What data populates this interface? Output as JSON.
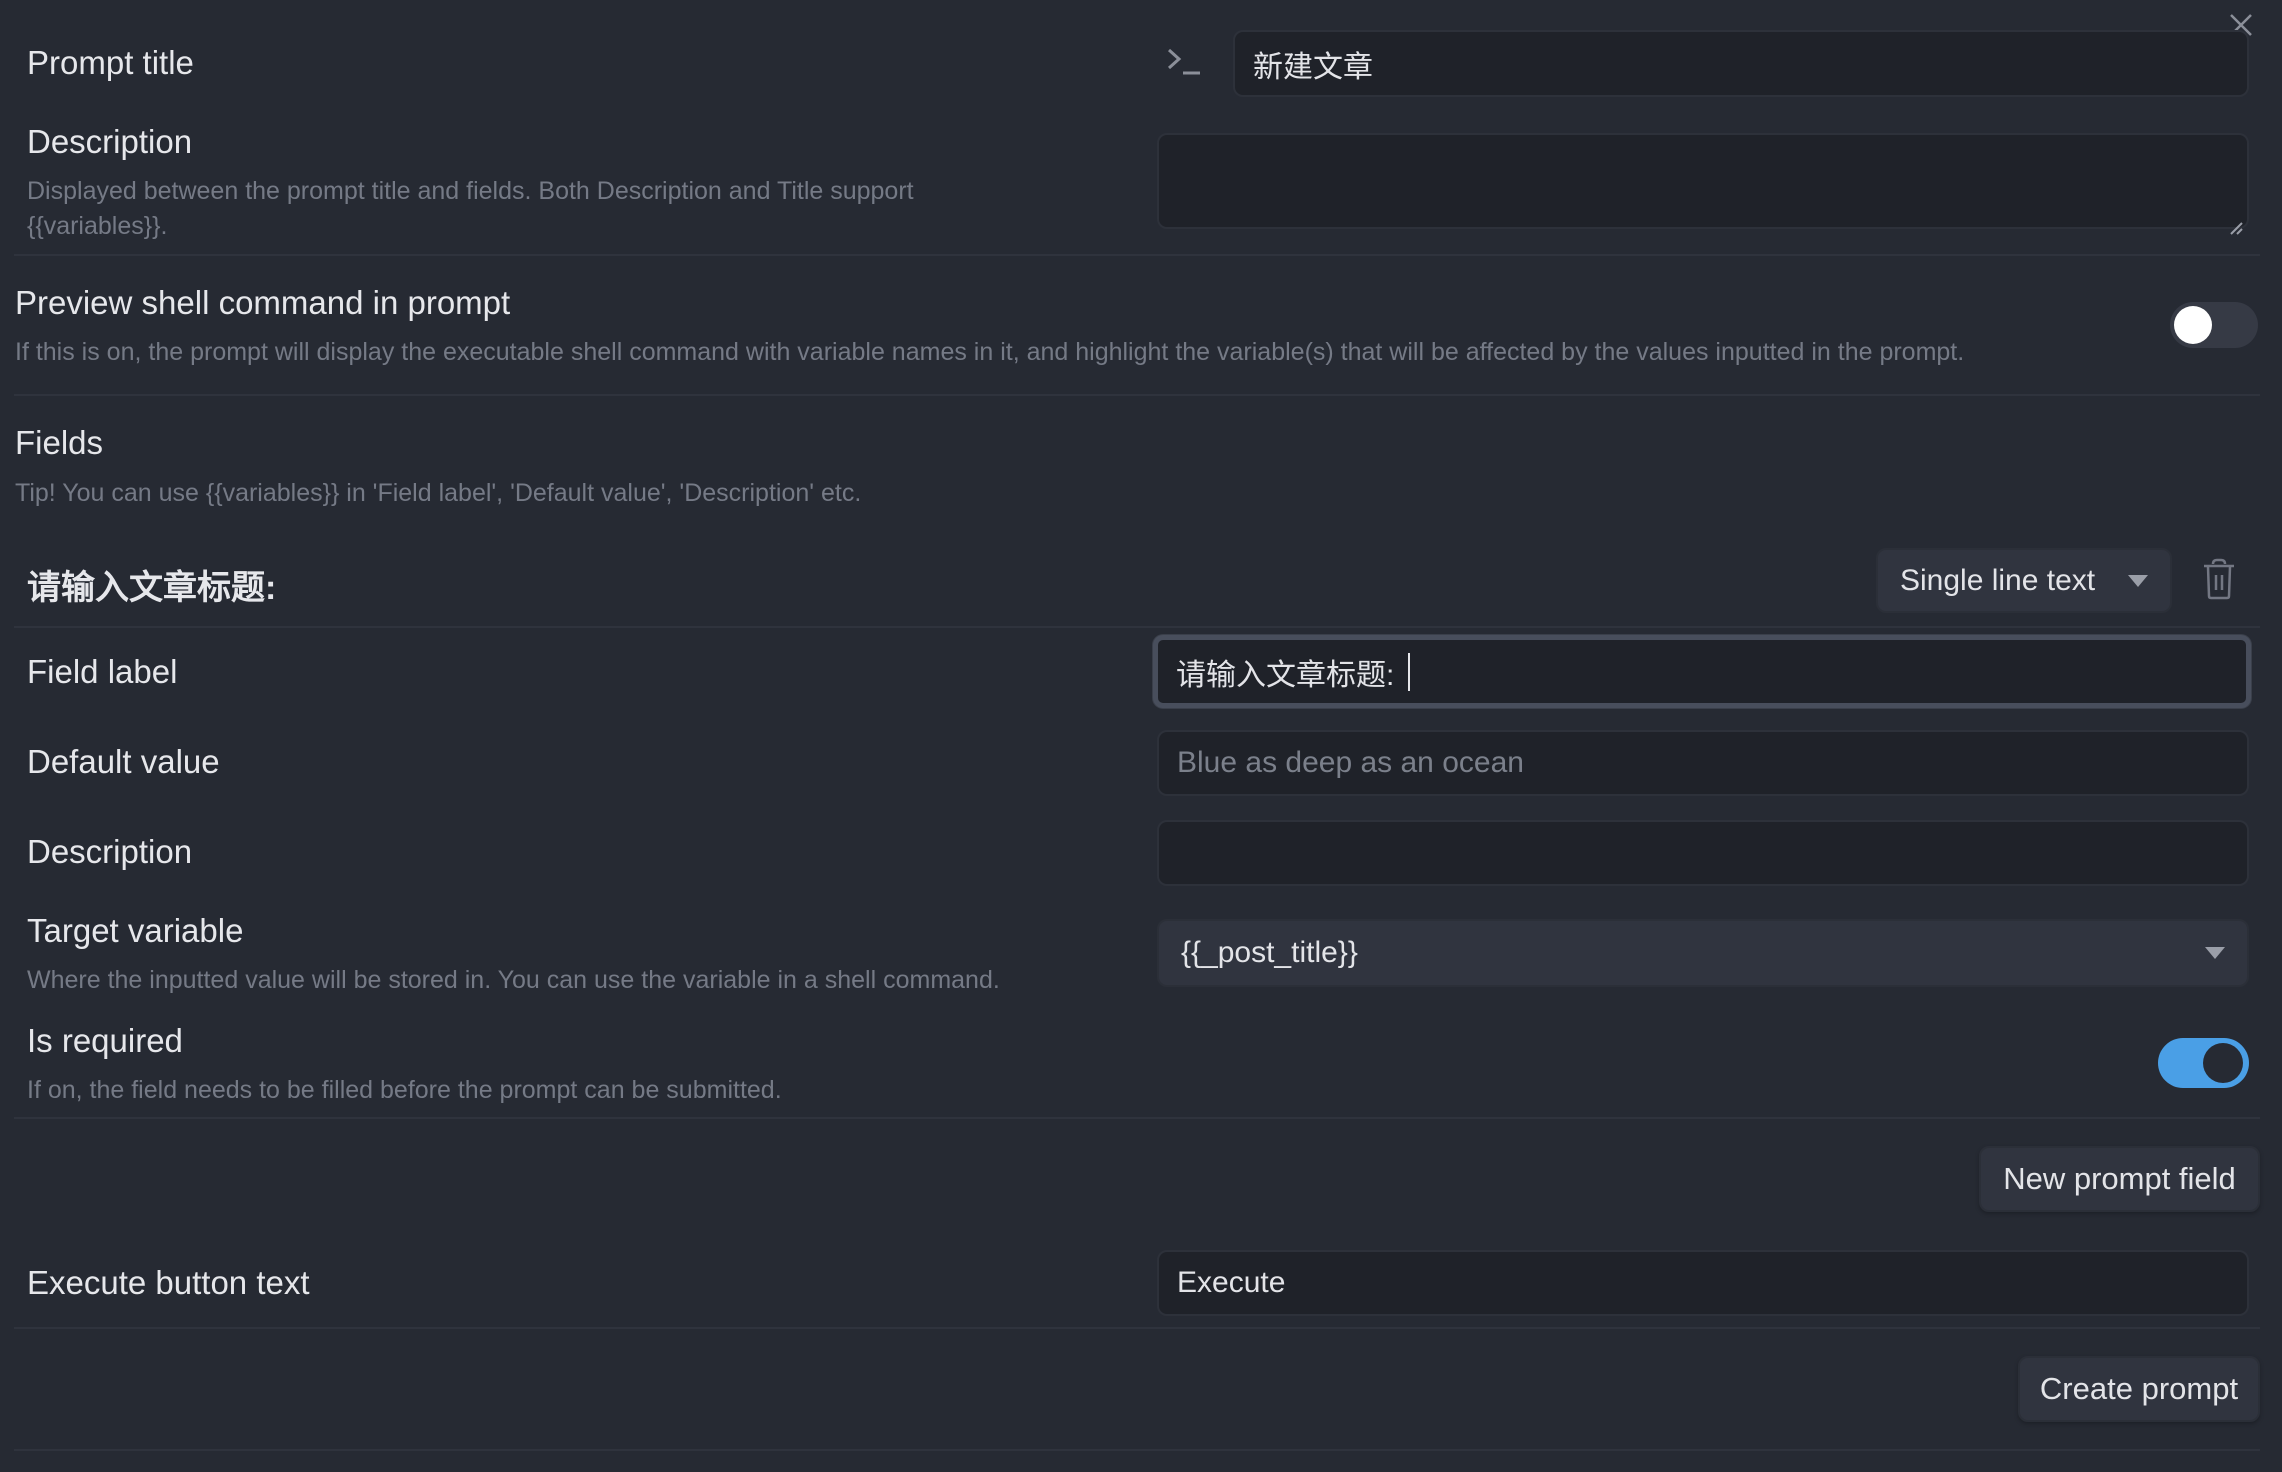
{
  "dialog": {
    "close_icon": "close-icon",
    "prompt_title": {
      "label": "Prompt title",
      "icon": "terminal-icon",
      "value": "新建文章"
    },
    "description": {
      "label": "Description",
      "help": "Displayed between the prompt title and fields. Both Description and Title support {{variables}}.",
      "value": ""
    },
    "preview_shell": {
      "label": "Preview shell command in prompt",
      "help": "If this is on, the prompt will display the executable shell command with variable names in it, and highlight the variable(s) that will be affected by the values inputted in the prompt.",
      "enabled": false
    },
    "fields_section": {
      "label": "Fields",
      "tip": "Tip! You can use {{variables}} in 'Field label', 'Default value', 'Description' etc."
    },
    "field": {
      "heading": "请输入文章标题:",
      "type_select": "Single line text",
      "delete_icon": "trash-icon",
      "field_label": {
        "label": "Field label",
        "value": "请输入文章标题:"
      },
      "default_value": {
        "label": "Default value",
        "placeholder": "Blue as deep as an ocean",
        "value": ""
      },
      "description": {
        "label": "Description",
        "value": ""
      },
      "target_variable": {
        "label": "Target variable",
        "help": "Where the inputted value will be stored in. You can use the variable in a shell command.",
        "value": "{{_post_title}}"
      },
      "is_required": {
        "label": "Is required",
        "help": "If on, the field needs to be filled before the prompt can be submitted.",
        "enabled": true
      }
    },
    "new_prompt_field_button": "New prompt field",
    "execute_button_text": {
      "label": "Execute button text",
      "value": "Execute"
    },
    "create_prompt_button": "Create prompt"
  },
  "colors": {
    "background": "#262a33",
    "input_bg": "#1f2229",
    "accent": "#4a9fe6",
    "toggle_off": "#3a3f4a"
  }
}
